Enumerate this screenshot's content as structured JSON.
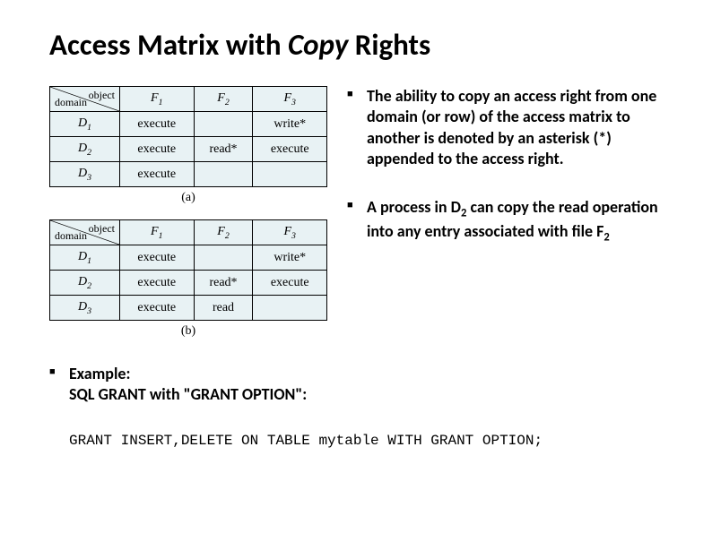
{
  "title_pre": "Access Matrix with ",
  "title_italic": "Copy",
  "title_post": " Rights",
  "matrixA": {
    "corner_top": "object",
    "corner_bottom": "domain",
    "cols": [
      "F",
      "F",
      "F"
    ],
    "col_subs": [
      "1",
      "2",
      "3"
    ],
    "rows": [
      {
        "d": "D",
        "ds": "1",
        "c": [
          "execute",
          "",
          "write*"
        ]
      },
      {
        "d": "D",
        "ds": "2",
        "c": [
          "execute",
          "read*",
          "execute"
        ]
      },
      {
        "d": "D",
        "ds": "3",
        "c": [
          "execute",
          "",
          ""
        ]
      }
    ],
    "caption": "(a)"
  },
  "matrixB": {
    "corner_top": "object",
    "corner_bottom": "domain",
    "cols": [
      "F",
      "F",
      "F"
    ],
    "col_subs": [
      "1",
      "2",
      "3"
    ],
    "rows": [
      {
        "d": "D",
        "ds": "1",
        "c": [
          "execute",
          "",
          "write*"
        ]
      },
      {
        "d": "D",
        "ds": "2",
        "c": [
          "execute",
          "read*",
          "execute"
        ]
      },
      {
        "d": "D",
        "ds": "3",
        "c": [
          "execute",
          "read",
          ""
        ]
      }
    ],
    "caption": "(b)"
  },
  "bullet1_a": "The ability to ",
  "bullet1_b": "copy",
  "bullet1_c": " an access right from one domain (or row) of the access matrix to another is denoted by an asterisk (*) appended to the access right.",
  "bullet2_a": "A process in D",
  "bullet2_sub1": "2",
  "bullet2_b": " can copy the read operation into any entry associated with file F",
  "bullet2_sub2": "2",
  "example_label": "Example:",
  "example_line2": "SQL GRANT with \"GRANT OPTION\":",
  "sql": "GRANT INSERT,DELETE ON TABLE mytable WITH GRANT OPTION;"
}
